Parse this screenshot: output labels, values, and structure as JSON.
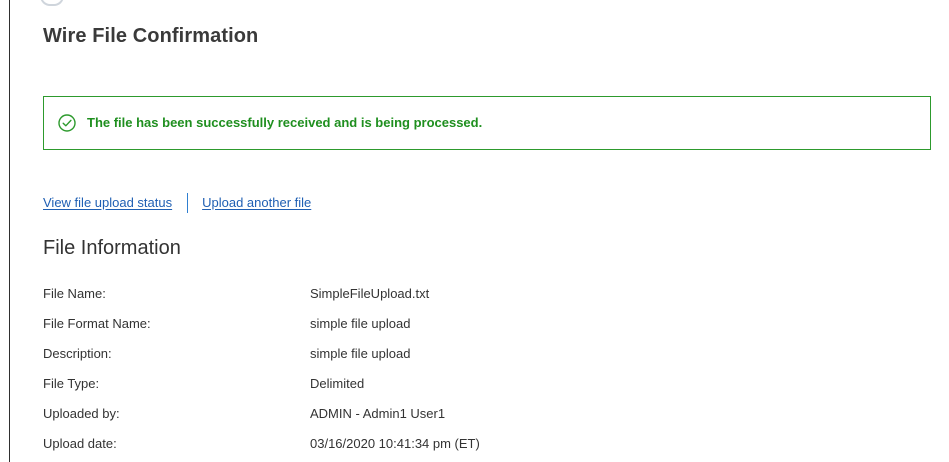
{
  "page": {
    "title": "Wire File Confirmation"
  },
  "alert": {
    "icon": "check-circle-icon",
    "message": "The file has been successfully received and is being processed.",
    "border_color": "#2d9a2d",
    "text_color": "#1f8f1f"
  },
  "actions": {
    "view_status": "View file upload status",
    "upload_another": "Upload another file",
    "link_color": "#1f5fb3"
  },
  "file_information": {
    "heading": "File Information",
    "rows": [
      {
        "label": "File Name:",
        "value": "SimpleFileUpload.txt"
      },
      {
        "label": "File Format Name:",
        "value": "simple file upload"
      },
      {
        "label": "Description:",
        "value": "simple file upload"
      },
      {
        "label": "File Type:",
        "value": "Delimited"
      },
      {
        "label": "Uploaded by:",
        "value": "ADMIN - Admin1 User1"
      },
      {
        "label": "Upload date:",
        "value": "03/16/2020 10:41:34 pm (ET)"
      }
    ]
  }
}
